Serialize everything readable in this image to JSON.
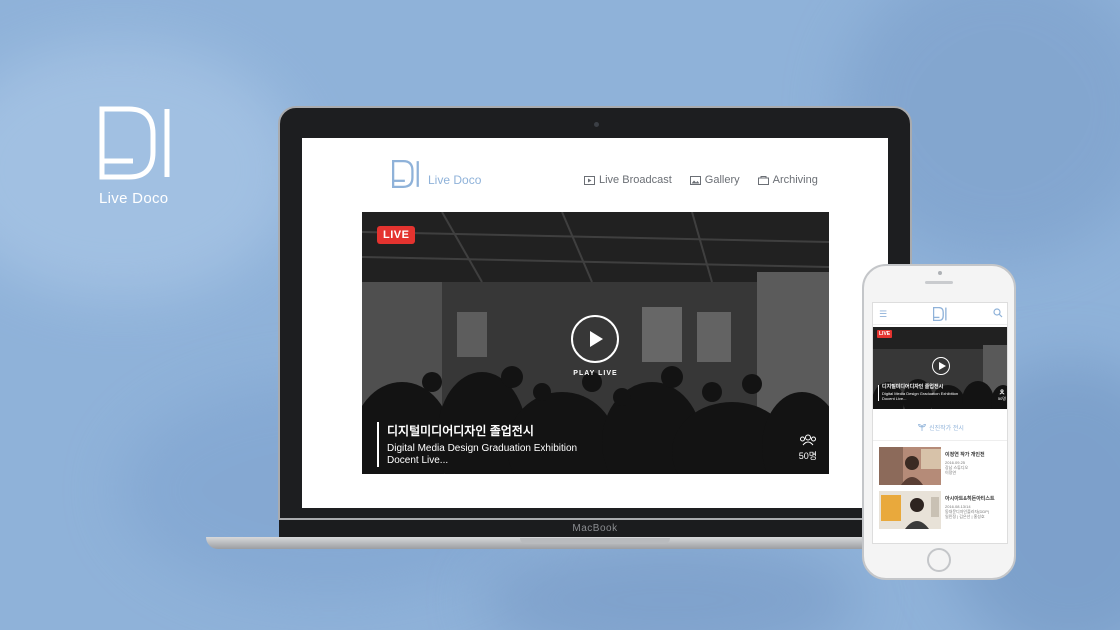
{
  "brand": {
    "name": "Live Doco"
  },
  "laptop": {
    "device_label": "MacBook",
    "site": {
      "logo_text": "Live Doco",
      "nav": [
        {
          "label": "Live Broadcast",
          "icon": "broadcast-icon"
        },
        {
          "label": "Gallery",
          "icon": "gallery-icon"
        },
        {
          "label": "Archiving",
          "icon": "archive-icon"
        }
      ],
      "video": {
        "badge": "LIVE",
        "play_label": "PLAY LIVE",
        "title_ko": "디지털미디어디자인 졸업전시",
        "title_en_line1": "Digital Media Design Graduation Exhibition",
        "title_en_line2": "Docent Live...",
        "viewers": "50명"
      }
    }
  },
  "phone": {
    "video": {
      "badge": "LIVE",
      "title_ko": "디지털미디어디자인 졸업전시",
      "title_en_line1": "Digital Media Design Graduation Exhibition",
      "title_en_line2": "Docent Live...",
      "viewers": "50명"
    },
    "section_title": "신진작가 전시",
    "cards": [
      {
        "title": "이정연 작가 개인전",
        "date": "2016.09.25",
        "location": "강남 스튜디오",
        "artist": "이정연"
      },
      {
        "title": "아시아트&히든아티스트",
        "date": "2016.08.13/14",
        "location": "동대문디자인플라자(DDP)",
        "artist": "일민정 | 김은선 | 홍성호"
      }
    ]
  },
  "colors": {
    "accent": "#8fb2d9",
    "live": "#e4332f",
    "background": "#8fb2d9"
  }
}
